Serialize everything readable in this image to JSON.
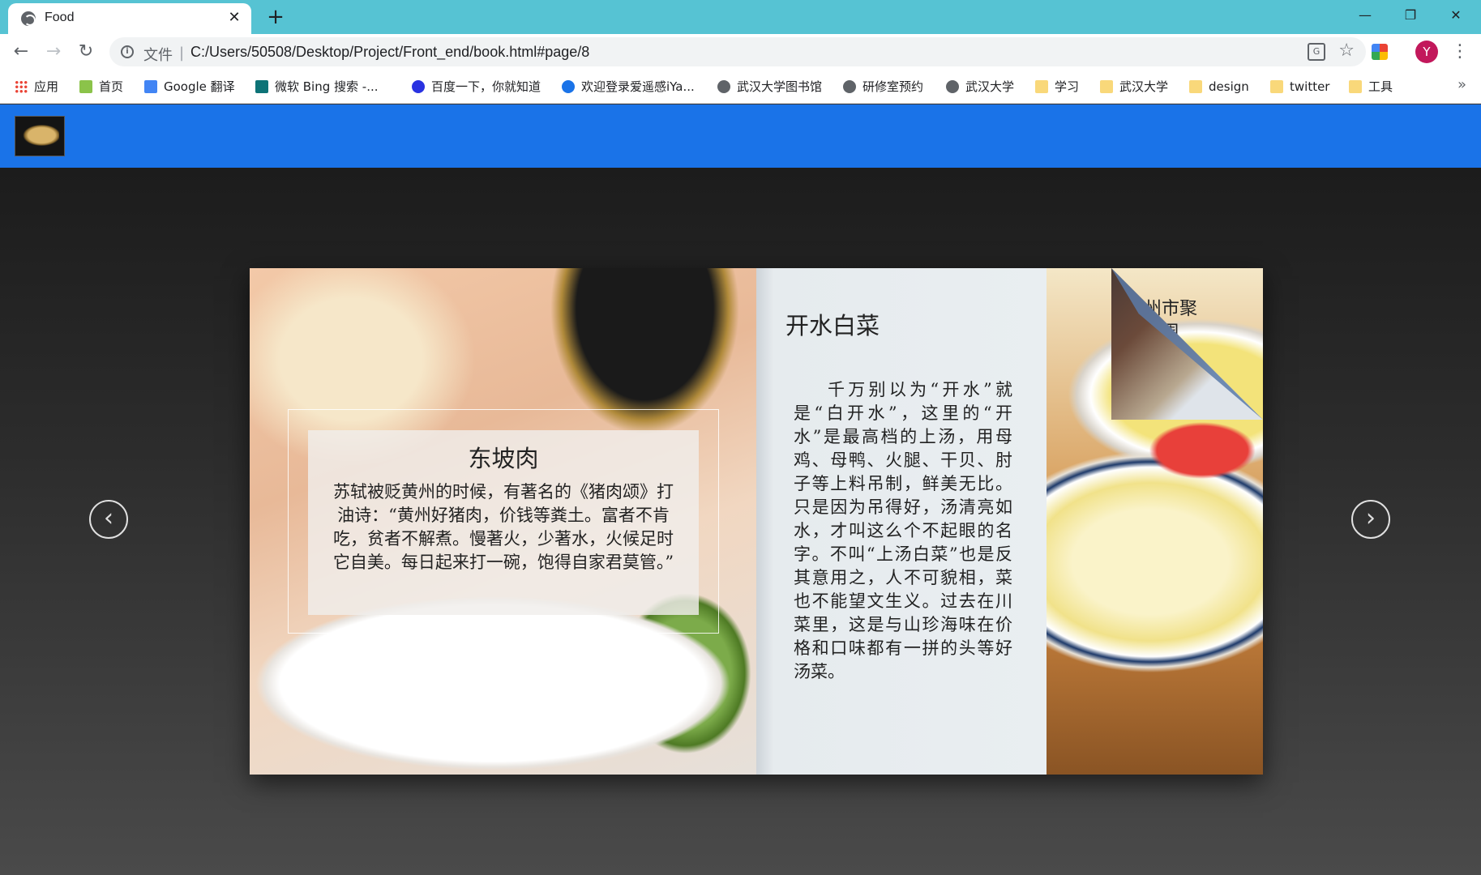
{
  "browser": {
    "tab_title": "Food",
    "url_prefix": "文件",
    "url_sep": "|",
    "url": "C:/Users/50508/Desktop/Project/Front_end/book.html#page/8",
    "avatar_letter": "Y",
    "bookmarks": [
      {
        "label": "应用",
        "icon": "apps-icon"
      },
      {
        "label": "首页",
        "icon": "page-icon"
      },
      {
        "label": "Google 翻译",
        "icon": "google-translate-icon"
      },
      {
        "label": "微软 Bing 搜索 -...",
        "icon": "bing-icon"
      },
      {
        "label": "百度一下，你就知道",
        "icon": "baidu-icon"
      },
      {
        "label": "欢迎登录爱遥感iYa...",
        "icon": "iya-icon"
      },
      {
        "label": "武汉大学图书馆",
        "icon": "globe-icon"
      },
      {
        "label": "研修室预约",
        "icon": "globe-icon"
      },
      {
        "label": "武汉大学",
        "icon": "globe-icon"
      },
      {
        "label": "学习",
        "icon": "folder-icon"
      },
      {
        "label": "武汉大学",
        "icon": "folder-icon"
      },
      {
        "label": "design",
        "icon": "folder-icon"
      },
      {
        "label": "twitter",
        "icon": "folder-icon"
      },
      {
        "label": "工具",
        "icon": "folder-icon"
      }
    ],
    "more_bookmarks": "»"
  },
  "header": {
    "accent_color": "#1a73e8",
    "logo": "china-map-logo"
  },
  "book": {
    "current_page": 8,
    "left_page": {
      "title": "东坡肉",
      "text": "苏轼被贬黄州的时候，有著名的《猪肉颂》打油诗：“黄州好猪肉，价钱等粪土。富者不肯吃，贫者不解煮。慢著火，少著水，火候足时它自美。每日起来打一碗，饱得自家君莫管。”"
    },
    "right_page": {
      "title": "开水白菜",
      "text": "千万别以为“开水”就是“白开水”，这里的“开水”是最高档的上汤，用母鸡、母鸭、火腿、干贝、肘子等上料吊制，鲜美无比。只是因为吊得好，汤清亮如水，才叫这么个不起眼的名字。不叫“上汤白菜”也是反其意用之，人不可貌相，菜也不能望文生义。过去在川菜里，这是与山珍海味在价格和口味都有一拼的头等好汤菜。"
    },
    "next_page_peek": "州市聚\n使周\n到",
    "prev_arrow": "‹",
    "next_arrow": "›"
  }
}
